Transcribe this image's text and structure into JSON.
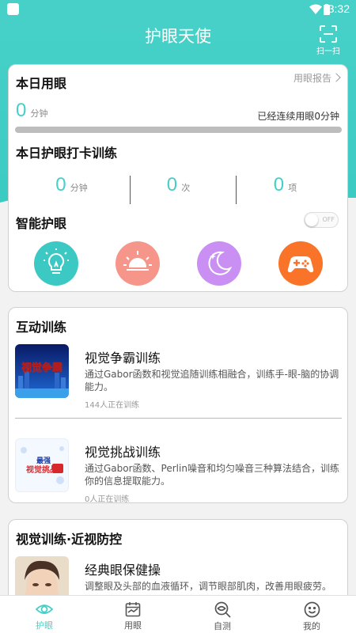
{
  "status_bar": {
    "time": "3:32"
  },
  "header": {
    "title": "护眼天使",
    "scan_label": "扫一扫"
  },
  "today_usage": {
    "title": "本日用眼",
    "report_link": "用眼报告",
    "minutes": "0",
    "minutes_unit": "分钟",
    "continuous_text": "已经连续用眼0分钟",
    "progress": 0
  },
  "checkin": {
    "title": "本日护眼打卡训练",
    "stats": [
      {
        "value": "0",
        "unit": "分钟"
      },
      {
        "value": "0",
        "unit": "次"
      },
      {
        "value": "0",
        "unit": "项"
      }
    ]
  },
  "smart_care": {
    "title": "智能护眼",
    "toggle_label": "OFF",
    "buttons": [
      {
        "name": "bulb-icon",
        "color": "#3cc9c4"
      },
      {
        "name": "sun-icon",
        "color": "#f6968a"
      },
      {
        "name": "moon-icon",
        "color": "#c98ff2"
      },
      {
        "name": "gamepad-icon",
        "color": "#f97428"
      }
    ]
  },
  "interactive": {
    "title": "互动训练",
    "items": [
      {
        "title": "视觉争霸训练",
        "desc": "通过Gabor函数和视觉追随训练相融合，训练手-眼-脑的协调能力。",
        "count": "144人正在训练",
        "thumb_text": "视觉争霸"
      },
      {
        "title": "视觉挑战训练",
        "desc": "通过Gabor函数、Perlin噪音和均匀噪音三种算法结合，训练你的信息提取能力。",
        "count": "0人正在训练",
        "thumb_text_1": "最强",
        "thumb_text_2": "视觉挑战"
      }
    ]
  },
  "vision": {
    "title": "视觉训练·近视防控",
    "items": [
      {
        "title": "经典眼保健操",
        "desc": "调整眼及头部的血液循环，调节眼部肌肉，改善用眼疲劳。"
      }
    ]
  },
  "tabs": [
    {
      "label": "护眼",
      "active": true
    },
    {
      "label": "用眼",
      "active": false
    },
    {
      "label": "自测",
      "active": false
    },
    {
      "label": "我的",
      "active": false
    }
  ],
  "colors": {
    "accent": "#46cfc6",
    "inactive": "#555555"
  }
}
